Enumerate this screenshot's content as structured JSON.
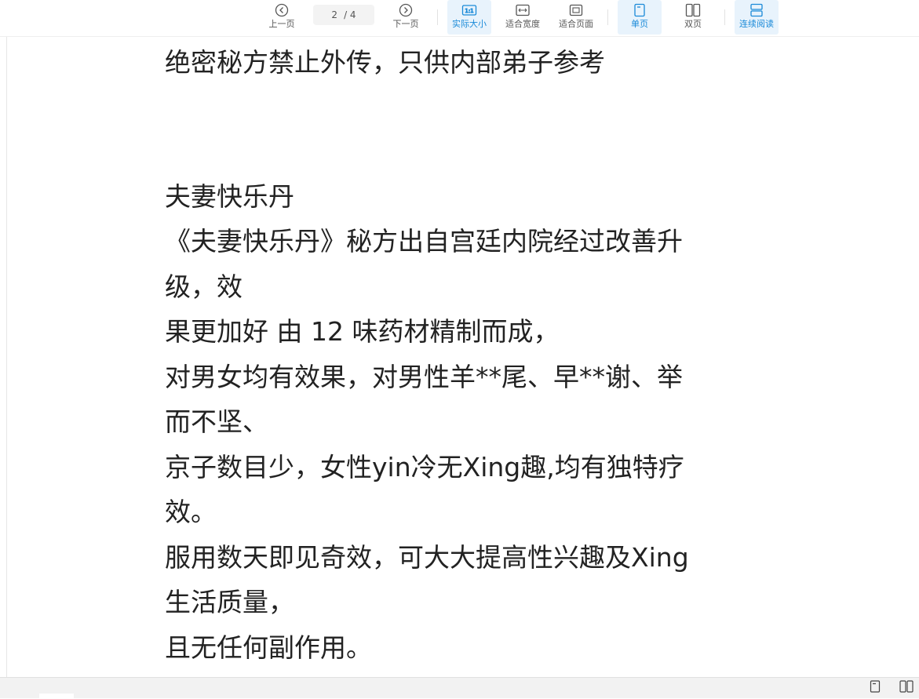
{
  "toolbar": {
    "prev_label": "上一页",
    "page_current": "2",
    "page_total": "/ 4",
    "next_label": "下一页",
    "actual_size_label": "实际大小",
    "actual_size_glyph": "1:1",
    "fit_width_label": "适合宽度",
    "fit_page_label": "适合页面",
    "single_page_label": "单页",
    "double_page_label": "双页",
    "continuous_label": "连续阅读",
    "accent_color": "#1a8ad8"
  },
  "document": {
    "lines": [
      "绝密秘方禁止外传，只供内部弟子参考",
      "",
      "",
      "夫妻快乐丹",
      "《夫妻快乐丹》秘方出自宫廷内院经过改善升",
      "级，效",
      "果更加好 由 12 味药材精制而成，",
      "对男女均有效果，对男性羊**尾、早**谢、举",
      "而不坚、",
      "京子数目少，女性yin冷无Xing趣,均有独特疗",
      "效。",
      "服用数天即见奇效，可大大提高性兴趣及Xing",
      "生活质量，",
      "且无任何副作用。"
    ]
  },
  "statusbar": {
    "single_icon": "single-page-icon",
    "double_icon": "double-page-icon"
  }
}
